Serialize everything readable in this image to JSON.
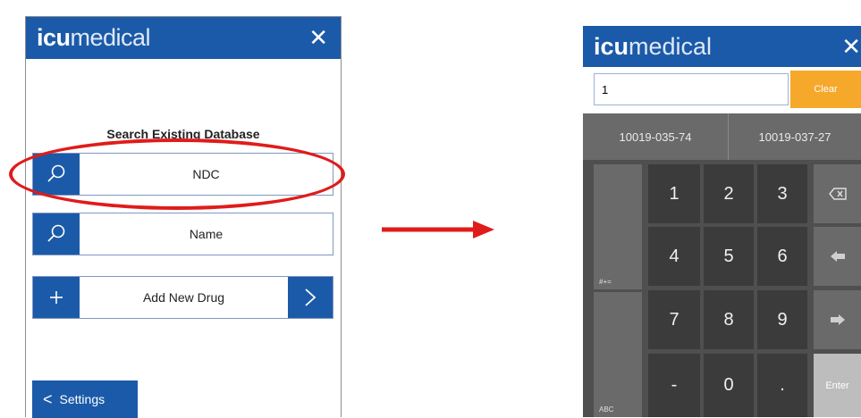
{
  "left_panel": {
    "logo_bold": "icu",
    "logo_light": "medical",
    "close_icon": "close-icon",
    "section_title": "Search Existing Database",
    "buttons": [
      {
        "label": "NDC",
        "icon": "search-icon"
      },
      {
        "label": "Name",
        "icon": "search-icon"
      },
      {
        "label": "Add New Drug",
        "icon": "plus-icon",
        "trailing_icon": "chevron-right-icon"
      }
    ],
    "settings_label": "Settings"
  },
  "annotation": {
    "highlight_color": "#e01b1b",
    "arrow_color": "#e01b1b"
  },
  "right_panel": {
    "logo_bold": "icu",
    "logo_light": "medical",
    "input_value": "1",
    "clear_label": "Clear",
    "suggestions": [
      "10019-035-74",
      "10019-037-27"
    ],
    "keypad": {
      "digits": [
        "1",
        "2",
        "3",
        "4",
        "5",
        "6",
        "7",
        "8",
        "9",
        "-",
        "0",
        "."
      ],
      "backspace_icon": "backspace-icon",
      "left_arrow_icon": "arrow-left-icon",
      "right_arrow_icon": "arrow-right-icon",
      "enter_label": "Enter",
      "symbols_label": "#+=",
      "abc_label": "ABC"
    }
  },
  "colors": {
    "brand_blue": "#1b5aa8",
    "clear_orange": "#f6a82a",
    "keypad_dark": "#3b3b3b",
    "keypad_side": "#6a6a6a"
  }
}
